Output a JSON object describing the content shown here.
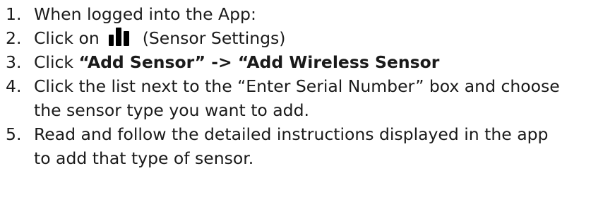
{
  "steps": [
    {
      "number": "1.",
      "text": "When logged into the App:"
    },
    {
      "number": "2.",
      "before_icon": "Click on",
      "icon": "bar-chart-icon",
      "after_icon": "(Sensor Settings)"
    },
    {
      "number": "3.",
      "prefix": "Click",
      "bold": "“Add Sensor” -> “Add Wireless Sensor"
    },
    {
      "number": "4.",
      "line1": "Click the list next to the “Enter Serial Number” box and choose",
      "line2": "the sensor type you want to add."
    },
    {
      "number": "5.",
      "line1": "Read and follow the detailed instructions displayed in the app",
      "line2": "to add that type of sensor."
    }
  ],
  "colors": {
    "text": "#1a1a1a",
    "icon": "#000000"
  }
}
